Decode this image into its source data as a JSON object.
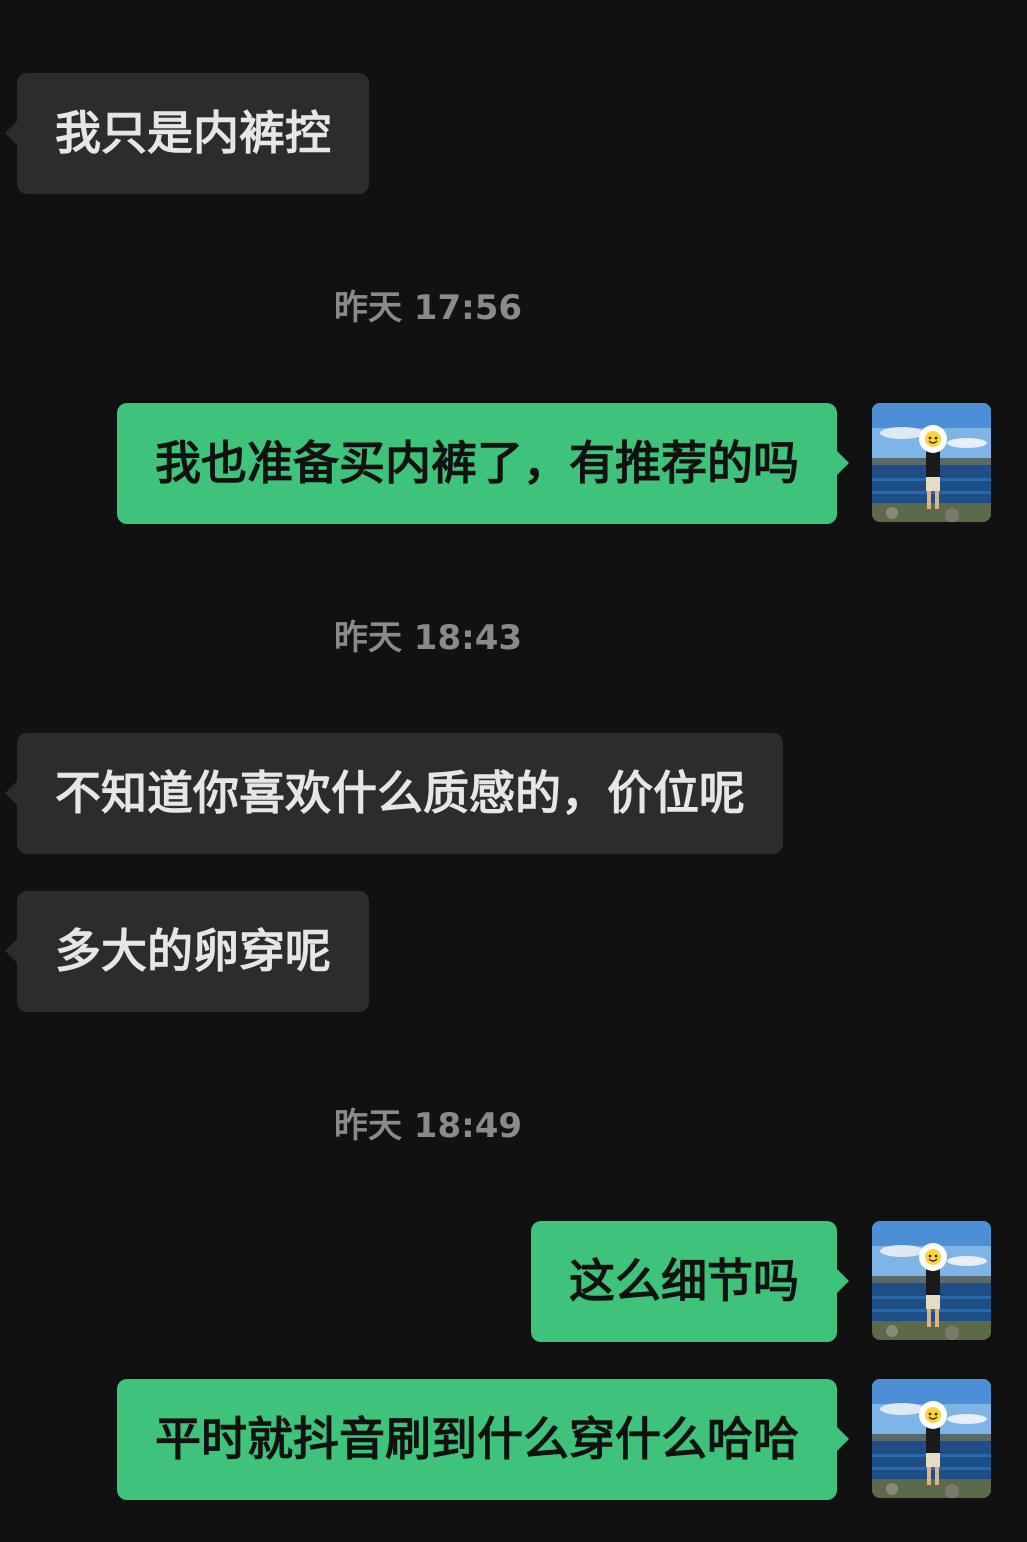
{
  "colors": {
    "background": "#111111",
    "incoming_bubble": "#2c2c2c",
    "outgoing_bubble": "#3fc27a",
    "timestamp_text": "#8a8a8a"
  },
  "messages": [
    {
      "direction": "incoming",
      "text": "我只是内裤控"
    },
    {
      "type": "timestamp",
      "text": "昨天 17:56"
    },
    {
      "direction": "outgoing",
      "text": "我也准备买内裤了，有推荐的吗",
      "avatar": "user-avatar-photo"
    },
    {
      "type": "timestamp",
      "text": "昨天 18:43"
    },
    {
      "direction": "incoming",
      "text": "不知道你喜欢什么质感的，价位呢"
    },
    {
      "direction": "incoming",
      "text": "多大的卵穿呢"
    },
    {
      "type": "timestamp",
      "text": "昨天 18:49"
    },
    {
      "direction": "outgoing",
      "text": "这么细节吗",
      "avatar": "user-avatar-photo"
    },
    {
      "direction": "outgoing",
      "text": "平时就抖音刷到什么穿什么哈哈",
      "avatar": "user-avatar-photo"
    }
  ]
}
